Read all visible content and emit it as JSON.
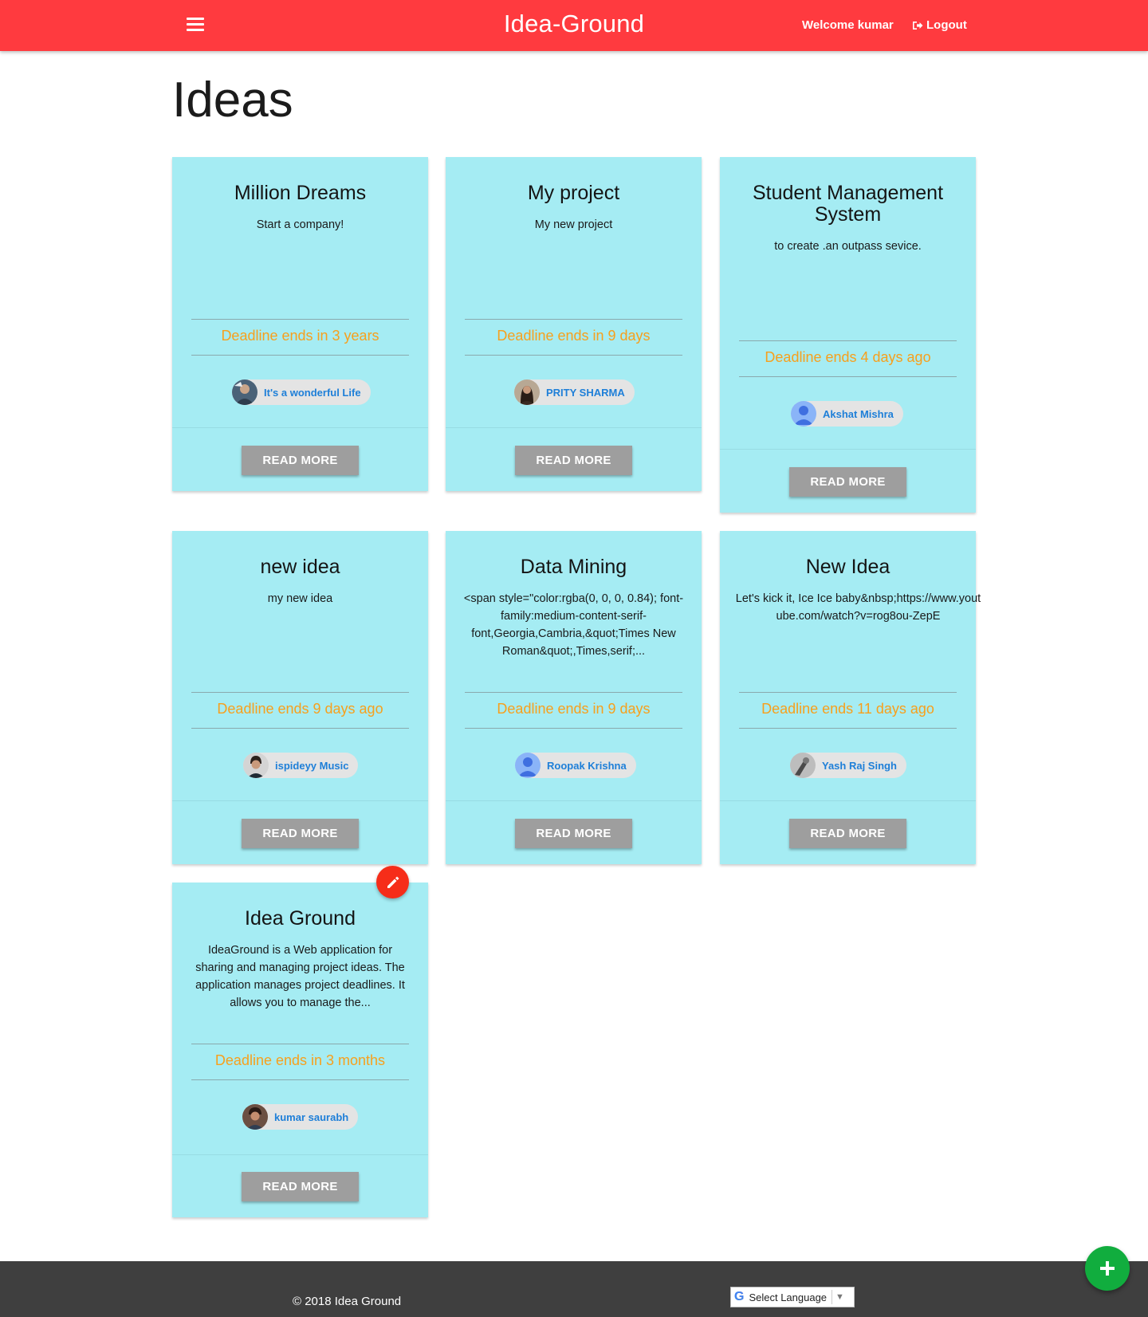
{
  "header": {
    "brand": "Idea-Ground",
    "welcome": "Welcome kumar",
    "logout_label": "Logout"
  },
  "page": {
    "title": "Ideas"
  },
  "cards": [
    {
      "title": "Million Dreams",
      "description": "Start a company!",
      "deadline": "Deadline ends in 3 years",
      "author": "It's a wonderful Life",
      "button": "READ MORE"
    },
    {
      "title": "My project",
      "description": "My new project",
      "deadline": "Deadline ends in 9 days",
      "author": "PRITY SHARMA",
      "button": "READ MORE"
    },
    {
      "title": "Student Management System",
      "description": "to create .an outpass sevice.",
      "deadline": "Deadline ends 4 days ago",
      "author": "Akshat Mishra",
      "button": "READ MORE"
    },
    {
      "title": "new idea",
      "description": "my new idea",
      "deadline": "Deadline ends 9 days ago",
      "author": "ispideyy Music",
      "button": "READ MORE"
    },
    {
      "title": "Data Mining",
      "description": "<span style=\"color:rgba(0, 0, 0, 0.84); font-family:medium-content-serif-font,Georgia,Cambria,&quot;Times New Roman&quot;,Times,serif;...",
      "deadline": "Deadline ends in 9 days",
      "author": "Roopak Krishna",
      "button": "READ MORE"
    },
    {
      "title": "New Idea",
      "description": "Let's kick it, Ice Ice baby&nbsp;https://www.youtube.com/watch?v=rog8ou-ZepE",
      "deadline": "Deadline ends 11 days ago",
      "author": "Yash Raj Singh",
      "button": "READ MORE"
    },
    {
      "title": "Idea Ground",
      "description": "IdeaGround is a Web application for sharing and managing project ideas. The application manages project deadlines. It allows you to manage the...",
      "deadline": "Deadline ends in 3 months",
      "author": "kumar saurabh",
      "button": "READ MORE"
    }
  ],
  "footer": {
    "copyright": "© 2018 Idea Ground",
    "language_select": "Select Language"
  },
  "icons": {
    "menu": "hamburger-menu-icon",
    "logout": "logout-icon",
    "edit": "pencil-icon",
    "add": "plus-icon",
    "google": "google-g-icon"
  },
  "colors": {
    "navbar": "#ff3a3f",
    "card": "#a5ecf3",
    "deadline": "#f7a01d",
    "author": "#1e7fd8",
    "button": "#9e9e9e",
    "edit_fab": "#f62d19",
    "add_fab": "#11ad3e",
    "footer": "#3f3f3f"
  }
}
